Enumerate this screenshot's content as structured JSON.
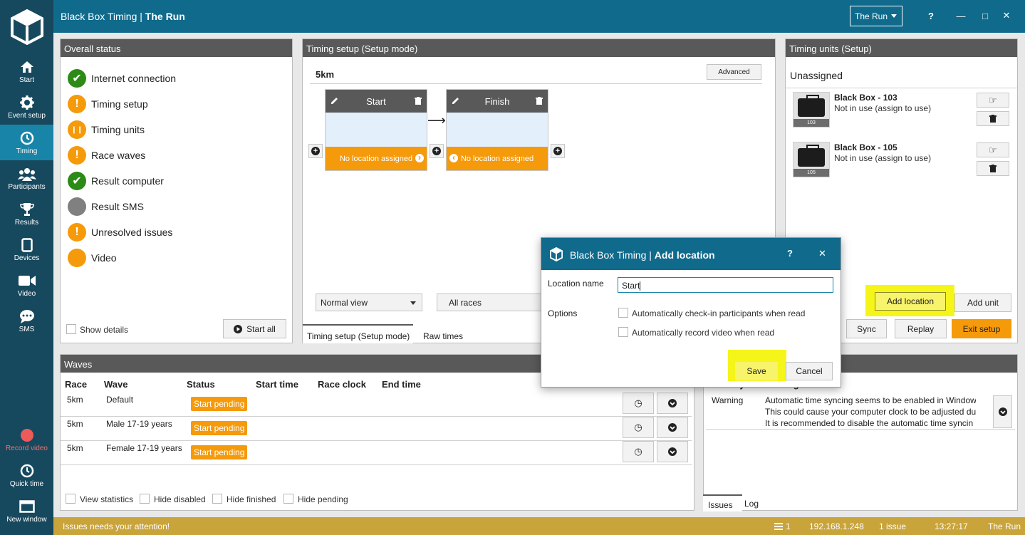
{
  "app": {
    "title_prefix": "Black Box Timing | ",
    "event_name": "The Run",
    "event_select_value": "The Run",
    "help": "?",
    "minimize": "—",
    "maximize": "□",
    "close": "✕"
  },
  "sidebar": {
    "items": [
      {
        "label": "Start",
        "icon": "home-icon"
      },
      {
        "label": "Event setup",
        "icon": "gear-icon"
      },
      {
        "label": "Timing",
        "icon": "clock-icon"
      },
      {
        "label": "Participants",
        "icon": "people-icon"
      },
      {
        "label": "Results",
        "icon": "trophy-icon"
      },
      {
        "label": "Devices",
        "icon": "tablet-icon"
      },
      {
        "label": "Video",
        "icon": "camera-icon"
      },
      {
        "label": "SMS",
        "icon": "chat-icon"
      }
    ],
    "bottom": [
      {
        "label": "Record video",
        "icon": "record-icon"
      },
      {
        "label": "Quick time",
        "icon": "clock-icon"
      },
      {
        "label": "New window",
        "icon": "window-icon"
      }
    ]
  },
  "overall_status": {
    "header": "Overall status",
    "items": [
      {
        "label": "Internet connection",
        "state": "ok"
      },
      {
        "label": "Timing setup",
        "state": "warning"
      },
      {
        "label": "Timing units",
        "state": "paused"
      },
      {
        "label": "Race waves",
        "state": "warning"
      },
      {
        "label": "Result computer",
        "state": "ok"
      },
      {
        "label": "Result SMS",
        "state": "off"
      },
      {
        "label": "Unresolved issues",
        "state": "warning"
      },
      {
        "label": "Video",
        "state": "pending"
      }
    ],
    "show_details": "Show details",
    "start_all": "Start all",
    "warning_glyph": "!",
    "pause_glyph": "❙❙",
    "check_glyph": "✔"
  },
  "timing_setup": {
    "header": "Timing setup (Setup mode)",
    "race": "5km",
    "advanced": "Advanced",
    "locations": [
      {
        "name": "Start",
        "footer": "No location assigned"
      },
      {
        "name": "Finish",
        "footer": "No location assigned"
      }
    ],
    "view_select": "Normal view",
    "races_select": "All races",
    "tabs": [
      "Timing setup (Setup mode)",
      "Raw times"
    ],
    "plus_glyph": "+",
    "arrow_right_glyph": "›",
    "arrow_left_glyph": "‹",
    "flow_arrow_glyph": "⟶"
  },
  "timing_units": {
    "header": "Timing units (Setup)",
    "unassigned": "Unassigned",
    "units": [
      {
        "name": "Black Box - 103",
        "status": "Not in use (assign to use)",
        "badge": "103"
      },
      {
        "name": "Black Box - 105",
        "status": "Not in use (assign to use)",
        "badge": "105"
      }
    ],
    "add_location": "Add location",
    "add_unit": "Add unit",
    "sync": "Sync",
    "replay": "Replay",
    "exit_setup": "Exit setup",
    "assign_glyph": "☞",
    "delete_glyph": "🗑"
  },
  "waves": {
    "header": "Waves",
    "columns": [
      "Race",
      "Wave",
      "Status",
      "Start time",
      "Race clock",
      "End time"
    ],
    "rows": [
      {
        "race": "5km",
        "wave": "Default",
        "status": "Start pending"
      },
      {
        "race": "5km",
        "wave": "Male 17-19 years",
        "status": "Start pending"
      },
      {
        "race": "5km",
        "wave": "Female 17-19 years",
        "status": "Start pending"
      }
    ],
    "checkboxes": [
      "View statistics",
      "Hide disabled",
      "Hide finished",
      "Hide pending"
    ],
    "clock_glyph": "◷",
    "expand_glyph": "⌄"
  },
  "issues": {
    "col1": "Severity",
    "col2": "Message",
    "rows": [
      {
        "severity": "Warning",
        "lines": [
          "Automatic time syncing seems to be enabled in Window",
          "This could cause your computer clock to be adjusted du",
          "It is recommended to disable the automatic time syncin"
        ]
      }
    ],
    "tabs": [
      "Issues",
      "Log"
    ]
  },
  "dialog": {
    "title_prefix": "Black Box Timing | ",
    "title": "Add location",
    "help": "?",
    "close": "✕",
    "location_name_label": "Location name",
    "location_name_value": "Start",
    "options_label": "Options",
    "options": [
      "Automatically check-in participants when read",
      "Automatically record video when read"
    ],
    "save": "Save",
    "cancel": "Cancel"
  },
  "statusbar": {
    "message": "Issues needs your attention!",
    "count": "1",
    "ip": "192.168.1.248",
    "issues": "1 issue",
    "time": "13:27:17",
    "event": "The Run"
  },
  "colors": {
    "titlebar": "#0f6a8c",
    "sidebar": "#17495e",
    "active_nav": "#1784a8",
    "orange": "#f59a0b",
    "green": "#2c8a16",
    "highlight": "#f5f51a",
    "statusbar": "#c9a43b"
  }
}
